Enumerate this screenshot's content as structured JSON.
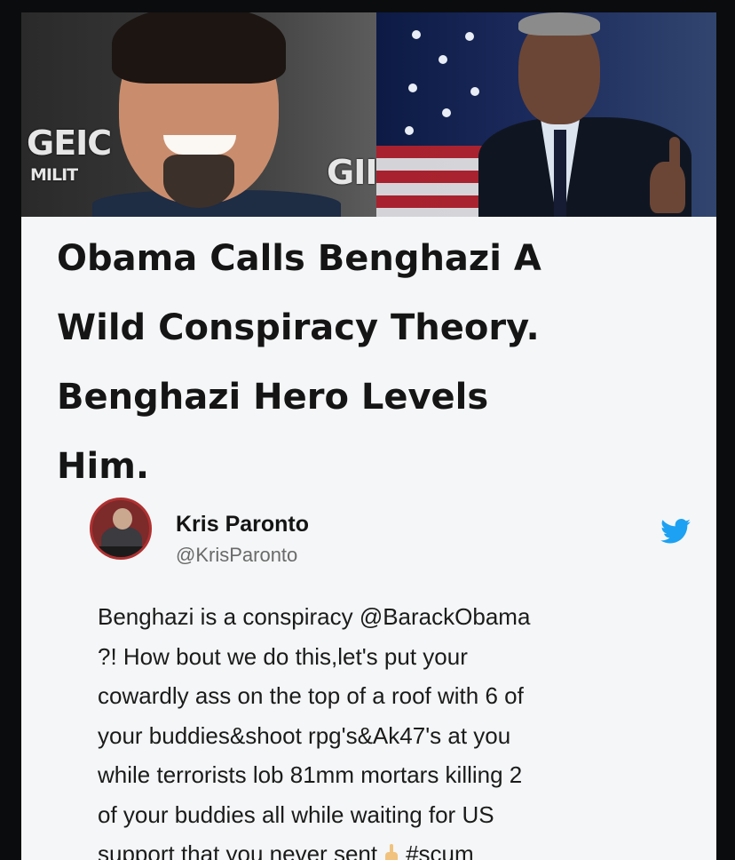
{
  "hero": {
    "logo_left_line1": "GEIC",
    "logo_left_line2": "MILIT",
    "logo_right": "GII"
  },
  "headline": {
    "lines": [
      "Obama Calls Benghazi A",
      "Wild Conspiracy Theory.",
      "Benghazi Hero Levels",
      "Him."
    ]
  },
  "tweet": {
    "author_name": "Kris Paronto",
    "author_handle": "@KrisParonto",
    "platform_icon": "twitter-bird-icon",
    "text_lines": [
      "Benghazi is a conspiracy @BarackObama",
      "?! How bout we do this,let's put your",
      "cowardly ass on the top of a roof with 6 of",
      "your buddies&shoot rpg's&Ak47's at you",
      "while terrorists lob 81mm mortars killing 2",
      "of your buddies all while waiting for US",
      "support that you never sent"
    ],
    "emoji": "middle-finger-emoji",
    "hashtag": "#scum"
  },
  "colors": {
    "twitter_blue": "#1da1f2",
    "card_bg": "#f4f6f7",
    "outer_bg": "#0b0c0e"
  }
}
